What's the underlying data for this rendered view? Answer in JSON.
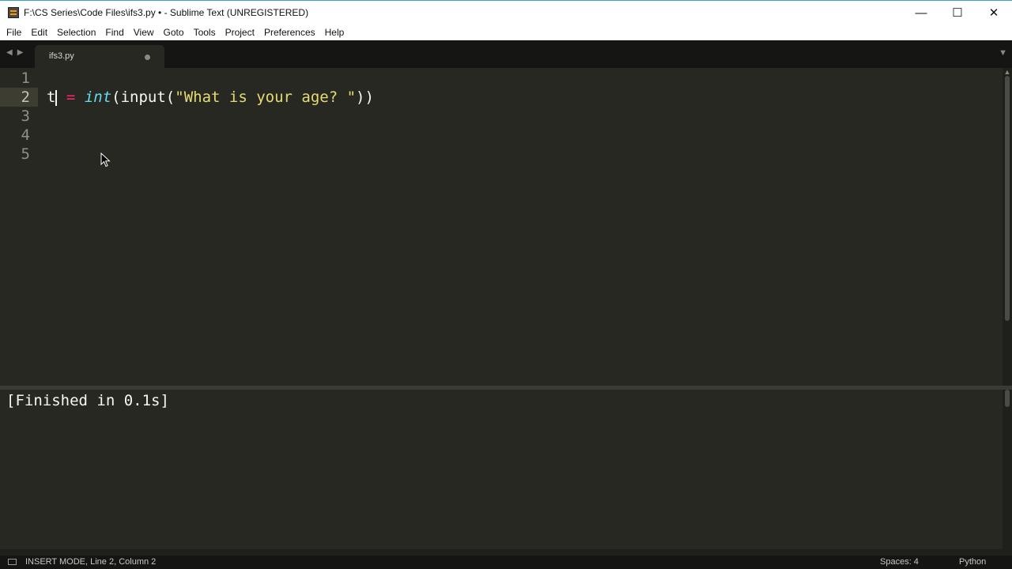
{
  "window": {
    "title": "F:\\CS Series\\Code Files\\ifs3.py • - Sublime Text (UNREGISTERED)",
    "controls": {
      "minimize": "—",
      "maximize": "☐",
      "close": "✕"
    }
  },
  "menu": [
    "File",
    "Edit",
    "Selection",
    "Find",
    "View",
    "Goto",
    "Tools",
    "Project",
    "Preferences",
    "Help"
  ],
  "tabbar": {
    "back_arrow": "◀",
    "forward_arrow": "▶",
    "tab_label": "ifs3.py",
    "overflow_arrow": "▼"
  },
  "editor": {
    "line_numbers": [
      "1",
      "2",
      "3",
      "4",
      "5"
    ],
    "active_line": 2,
    "line2": {
      "var": "t",
      "op": "=",
      "fn": "int",
      "open1": "(",
      "call": "input",
      "open2": "(",
      "str": "\"What is your age? \"",
      "close": "))"
    }
  },
  "output": {
    "text": "[Finished in 0.1s]"
  },
  "status": {
    "mode": "INSERT MODE, Line 2, Column 2",
    "spaces": "Spaces: 4",
    "syntax": "Python"
  },
  "colors": {
    "background": "#272822",
    "keyword_operator": "#f92672",
    "function": "#66d9ef",
    "string": "#e6db74"
  }
}
